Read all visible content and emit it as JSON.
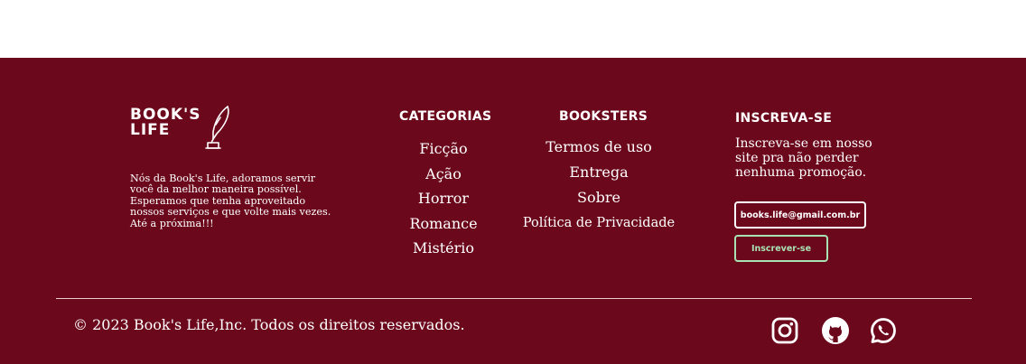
{
  "brand": {
    "line1": "BOOK'S",
    "line2": "LIFE"
  },
  "about": {
    "lines": [
      "Nós da Book's Life, adoramos servir",
      "você da melhor maneira possível.",
      "Esperamos que tenha aproveitado",
      "nossos serviços e que volte mais vezes.",
      "Até a próxima!!!"
    ]
  },
  "categories": {
    "heading": "CATEGORIAS",
    "items": [
      "Ficção",
      "Ação",
      "Horror",
      "Romance",
      "Mistério"
    ]
  },
  "booksters": {
    "heading": "BOOKSTERS",
    "items": [
      "Termos de uso",
      "Entrega",
      "Sobre",
      "Política de Privacidade"
    ]
  },
  "subscribe": {
    "heading": "INSCREVA-SE",
    "lines": [
      "Inscreva-se em nosso",
      "site pra não perder",
      "nenhuma promoção."
    ],
    "email_placeholder": "books.life@gmail.com.br",
    "button_label": "Inscrever-se"
  },
  "footer": {
    "copyright": "© 2023 Book's Life,Inc. Todos os direitos reservados."
  },
  "social": [
    "instagram-icon",
    "github-icon",
    "whatsapp-icon"
  ],
  "colors": {
    "background": "#6b081c",
    "accent": "#a8e3b4",
    "text": "#ffffff"
  }
}
